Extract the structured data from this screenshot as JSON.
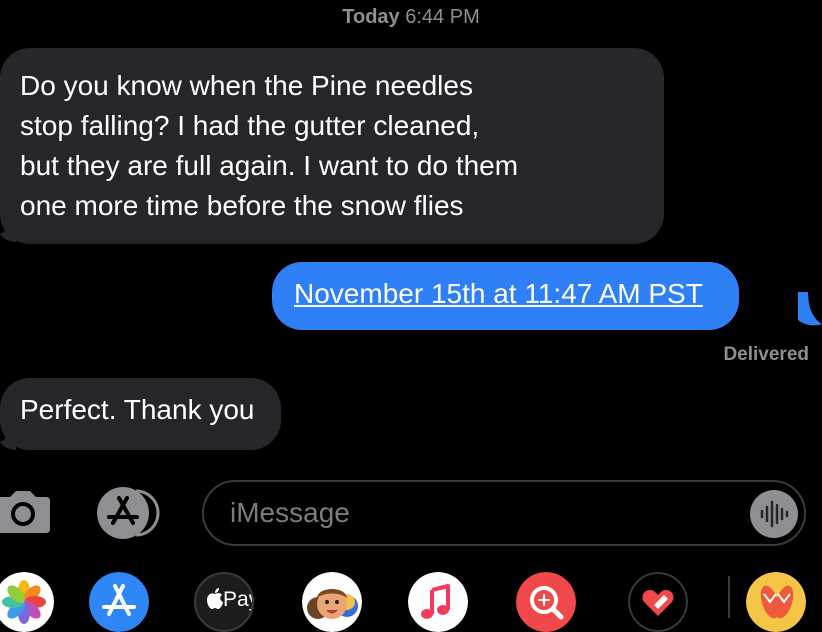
{
  "header": {
    "day": "Today",
    "time": "6:44 PM"
  },
  "messages": [
    {
      "direction": "incoming",
      "lines": [
        "Do you know when the Pine needles",
        "stop falling? I had the gutter cleaned,",
        "but they are full again. I want to do them",
        "one more time before the snow flies"
      ]
    },
    {
      "direction": "outgoing",
      "text": "November 15th at 11:47 AM PST"
    },
    {
      "direction": "incoming",
      "text": "Perfect. Thank you"
    }
  ],
  "status": "Delivered",
  "compose": {
    "placeholder": "iMessage"
  },
  "app_tray": {
    "apple_pay_label": "Pay",
    "icons": [
      "photos-icon",
      "app-store-icon",
      "apple-pay-icon",
      "memoji-icon",
      "music-icon",
      "image-search-icon",
      "digital-touch-icon",
      "stickers-icon"
    ]
  },
  "colors": {
    "background": "#000000",
    "incoming_bubble": "#26262a",
    "outgoing_bubble": "#2f80f6",
    "secondary_text": "#8e8e93"
  }
}
